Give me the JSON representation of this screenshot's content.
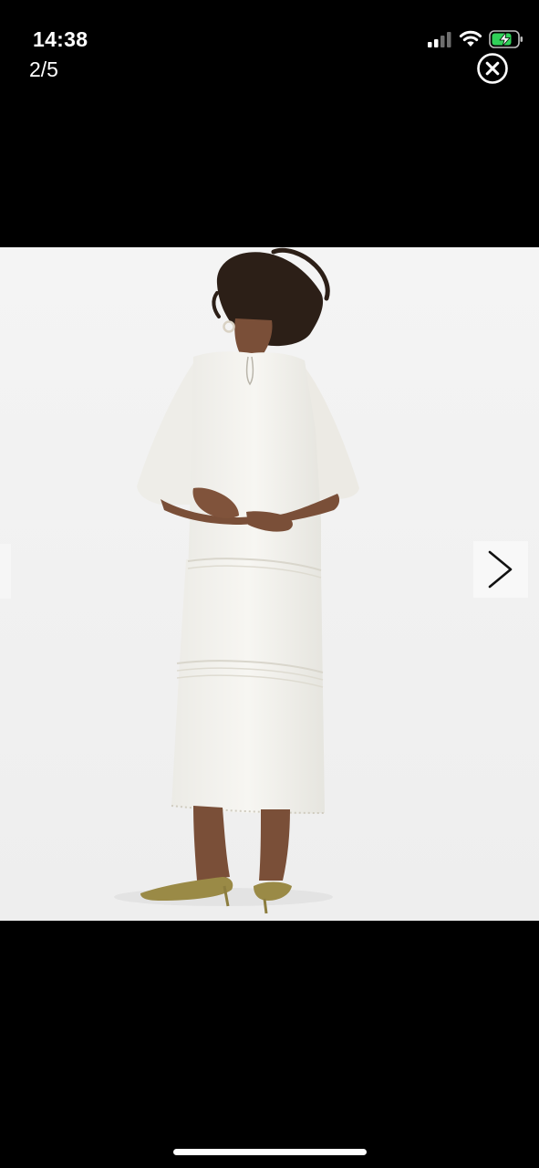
{
  "status_bar": {
    "time": "14:38",
    "signal_icon": "cellular-signal-icon",
    "wifi_icon": "wifi-icon",
    "battery_icon": "battery-charging-icon",
    "battery_color": "#30d158"
  },
  "viewer": {
    "counter": "2/5",
    "close_icon": "close-circle-icon",
    "next_icon": "chevron-right-icon",
    "background_color": "#000000"
  },
  "photo": {
    "subject": "product-photo",
    "background_color": "#f1f1f1"
  }
}
